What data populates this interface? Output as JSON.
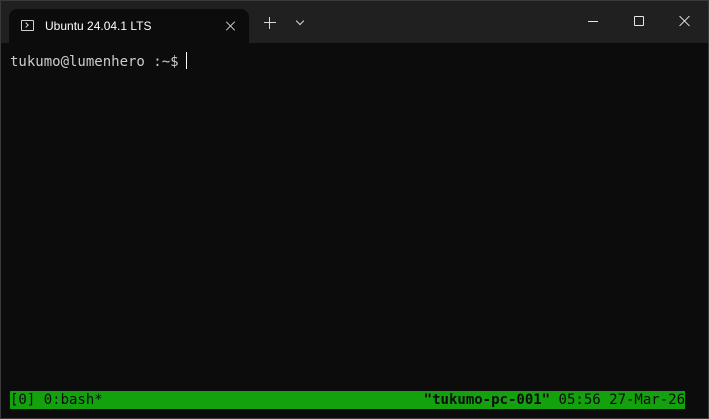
{
  "window": {
    "tab_title": "Ubuntu 24.04.1 LTS",
    "tab_icon": "terminal-icon"
  },
  "terminal": {
    "prompt": "tukumo@lumenhero :~$"
  },
  "tmux": {
    "session_window": "[0] 0:bash*",
    "hostname": "\"tukumo-pc-001\"",
    "time": "05:56",
    "date": "27-Mar-26",
    "bar_color": "#13a10e"
  }
}
